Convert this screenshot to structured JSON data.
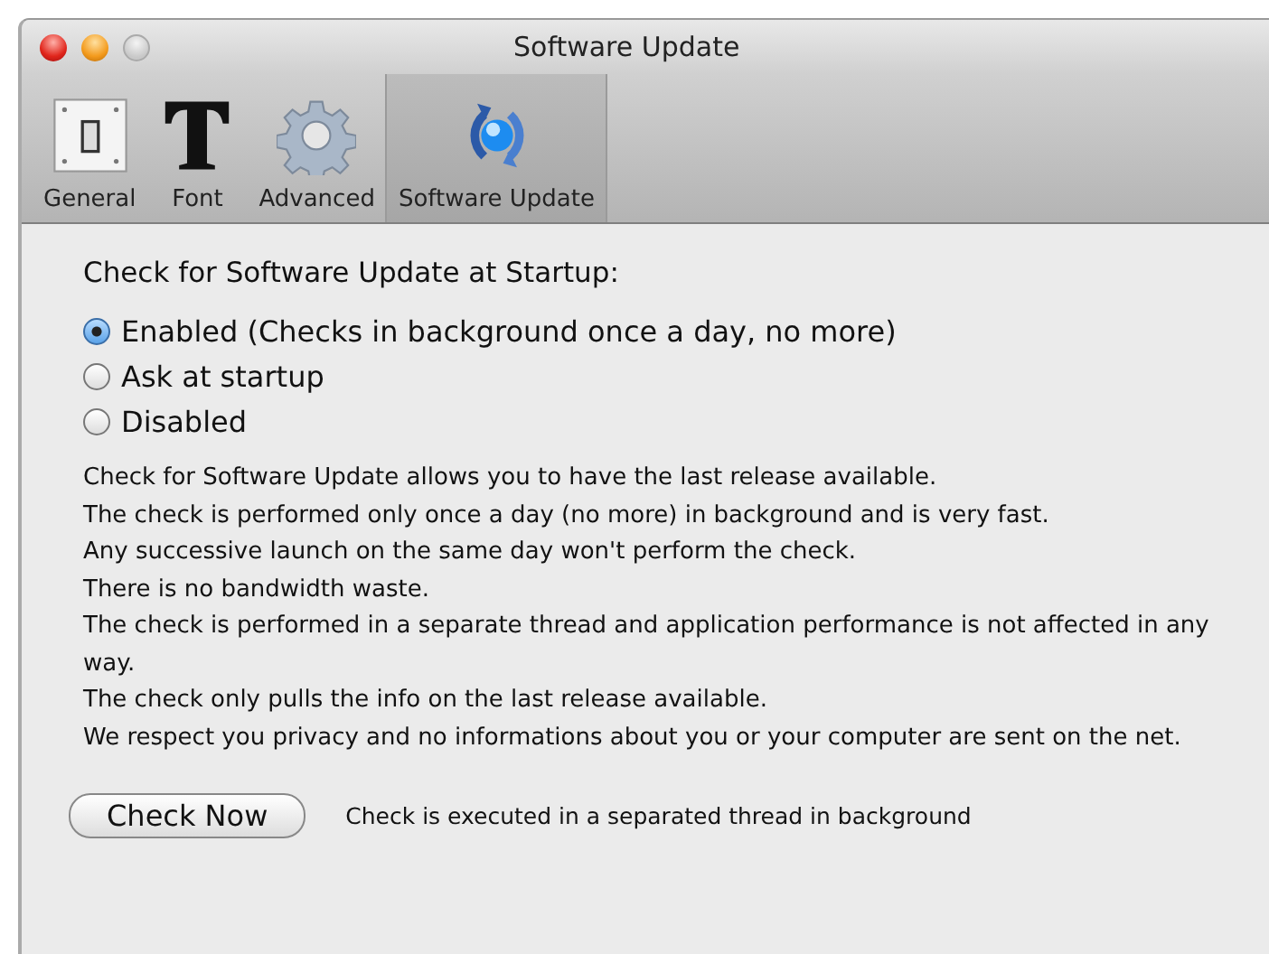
{
  "window": {
    "title": "Software Update"
  },
  "tabs": [
    {
      "label": "General",
      "kind": "switch",
      "selected": false
    },
    {
      "label": "Font",
      "kind": "font",
      "selected": false
    },
    {
      "label": "Advanced",
      "kind": "gear",
      "selected": false
    },
    {
      "label": "Software Update",
      "kind": "update",
      "selected": true
    }
  ],
  "startup": {
    "heading": "Check for Software Update at Startup:",
    "options": [
      {
        "label": "Enabled (Checks in background once a day, no more)",
        "selected": true
      },
      {
        "label": "Ask at startup",
        "selected": false
      },
      {
        "label": "Disabled",
        "selected": false
      }
    ]
  },
  "description": [
    "Check for Software Update allows you to have the last release available.",
    "The check is performed only once a day (no more) in background and is very fast.",
    "Any successive launch on the same day won't perform the check.",
    "There is no bandwidth waste.",
    "The check is performed in a separate thread and application performance is not affected in any way.",
    "The check only pulls the info on the last release available.",
    "We respect you privacy and no informations about you or your computer are sent on the net."
  ],
  "check_button": "Check Now",
  "check_note": "Check is executed in a separated thread in background"
}
